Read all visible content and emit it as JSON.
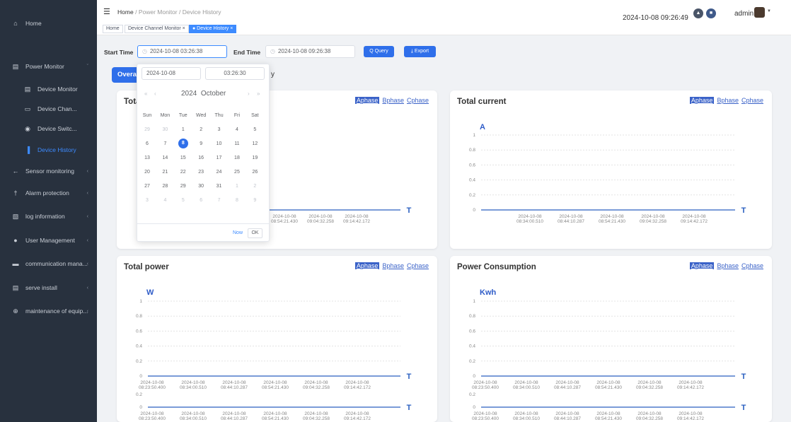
{
  "sidebar": {
    "items": [
      {
        "label": "Home",
        "icon": "home-icon",
        "glyph": "⌂",
        "arrow": ""
      },
      {
        "label": "Power Monitor",
        "icon": "monitor-icon",
        "glyph": "▤",
        "arrow": "ˇ"
      },
      {
        "label": "Device Monitor",
        "icon": "monitor-icon",
        "glyph": "▤",
        "arrow": ""
      },
      {
        "label": "Device Chan...",
        "icon": "channel-icon",
        "glyph": "▭",
        "arrow": ""
      },
      {
        "label": "Device Switc...",
        "icon": "switch-icon",
        "glyph": "◉",
        "arrow": ""
      },
      {
        "label": "Device History",
        "icon": "bar-chart-icon",
        "glyph": "▐",
        "arrow": ""
      },
      {
        "label": "Sensor monitoring",
        "icon": "sensor-icon",
        "glyph": "←",
        "arrow": "‹"
      },
      {
        "label": "Alarm protection",
        "icon": "alarm-icon",
        "glyph": "†",
        "arrow": "‹"
      },
      {
        "label": "log information",
        "icon": "log-icon",
        "glyph": "▧",
        "arrow": "‹"
      },
      {
        "label": "User Management",
        "icon": "user-icon",
        "glyph": "●",
        "arrow": "‹"
      },
      {
        "label": "communication mana...",
        "icon": "communication-icon",
        "glyph": "▬",
        "arrow": "‹"
      },
      {
        "label": "serve install",
        "icon": "server-icon",
        "glyph": "▤",
        "arrow": "‹"
      },
      {
        "label": "maintenance of equip...",
        "icon": "maintenance-icon",
        "glyph": "⊕",
        "arrow": "‹"
      }
    ]
  },
  "header": {
    "breadcrumb": {
      "home": "Home",
      "sep": "/",
      "level1": "Power Monitor",
      "level2": "Device History"
    },
    "datetime": "2024-10-08 09:26:49",
    "user": "admin"
  },
  "tags": [
    {
      "label": "Home"
    },
    {
      "label": "Device Channel Monitor ×"
    },
    {
      "label": "● Device History ×"
    }
  ],
  "filter": {
    "start_label": "Start Time",
    "start_value": "2024-10-08 03:26:38",
    "end_label": "End Time",
    "end_value": "2024-10-08 09:26:38",
    "query_label": "Q Query",
    "export_label": "⤓ Export"
  },
  "tabs": {
    "active": "Overa",
    "tail": "y"
  },
  "picker": {
    "date_input": "2024-10-08",
    "time_input": "03:26:30",
    "year": "2024",
    "month": "October",
    "weekdays": [
      "Sun",
      "Mon",
      "Tue",
      "Wed",
      "Thu",
      "Fri",
      "Sat"
    ],
    "weeks": [
      [
        "29",
        "30",
        "1",
        "2",
        "3",
        "4",
        "5"
      ],
      [
        "6",
        "7",
        "8",
        "9",
        "10",
        "11",
        "12"
      ],
      [
        "13",
        "14",
        "15",
        "16",
        "17",
        "18",
        "19"
      ],
      [
        "20",
        "21",
        "22",
        "23",
        "24",
        "25",
        "26"
      ],
      [
        "27",
        "28",
        "29",
        "30",
        "31",
        "1",
        "2"
      ],
      [
        "3",
        "4",
        "5",
        "6",
        "7",
        "8",
        "9"
      ]
    ],
    "selected": "8",
    "now_label": "Now",
    "ok_label": "OK"
  },
  "phases": [
    "Aphase",
    "Bphase",
    "Cphase"
  ],
  "panels": [
    {
      "title": "Tota",
      "unit": ""
    },
    {
      "title": "Total current",
      "unit": "A"
    },
    {
      "title": "Total power",
      "unit": "W"
    },
    {
      "title": "Power Consumption",
      "unit": "Kwh"
    }
  ],
  "axis_t": "T",
  "chart_data": [
    {
      "type": "line",
      "title": "Total current",
      "ylabel": "A",
      "xlabel": "T",
      "yticks": [
        "1",
        "0.8",
        "0.6",
        "0.4",
        "0.2",
        "0"
      ],
      "x": [
        "2024-10-08 08:34:00.510",
        "2024-10-08 08:44:10.287",
        "2024-10-08 08:54:21.430",
        "2024-10-08 09:04:32.258",
        "2024-10-08 09:14:42.172"
      ],
      "series": [
        {
          "values": []
        }
      ],
      "ylim": [
        0,
        1
      ],
      "grid": true
    },
    {
      "type": "line",
      "title": "Total power",
      "ylabel": "W",
      "xlabel": "T",
      "yticks": [
        "1",
        "0.8",
        "0.6",
        "0.4",
        "0.2",
        "0"
      ],
      "x": [
        "2024-10-08 08:23:50.400",
        "2024-10-08 08:34:00.510",
        "2024-10-08 08:44:10.287",
        "2024-10-08 08:54:21.430",
        "2024-10-08 09:04:32.258",
        "2024-10-08 09:14:42.172"
      ],
      "series": [
        {
          "values": []
        }
      ],
      "ylim": [
        0,
        1
      ],
      "grid": true
    },
    {
      "type": "line",
      "title": "Power Consumption",
      "ylabel": "Kwh",
      "xlabel": "T",
      "yticks": [
        "1",
        "0.8",
        "0.6",
        "0.4",
        "0.2",
        "0"
      ],
      "x": [
        "2024-10-08 08:23:50.400",
        "2024-10-08 08:34:00.510",
        "2024-10-08 08:44:10.287",
        "2024-10-08 08:54:21.430",
        "2024-10-08 09:04:32.258",
        "2024-10-08 09:14:42.172"
      ],
      "series": [
        {
          "values": []
        }
      ],
      "ylim": [
        0,
        1
      ],
      "grid": true
    }
  ],
  "first_panel_x": [
    "2024-10-08 08:54:21.430",
    "2024-10-08 09:04:32.258",
    "2024-10-08 09:14:42.172"
  ],
  "lower_tick": "0.2",
  "lower_zero": "0",
  "colors": {
    "sidebar": "#28313e",
    "accent": "#2f6fea",
    "link": "#3a62c8"
  }
}
